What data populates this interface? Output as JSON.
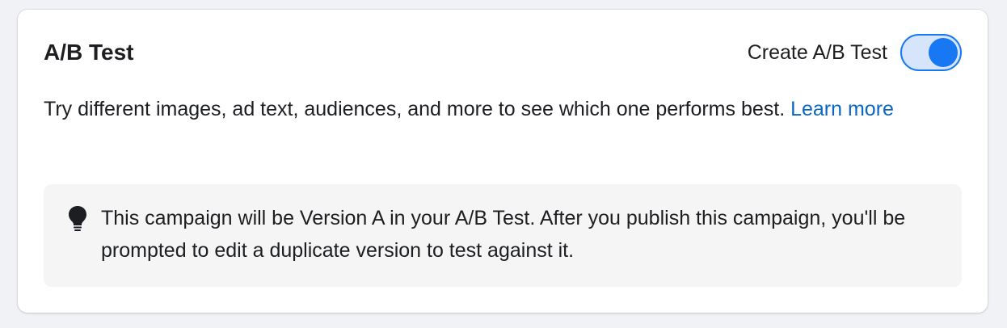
{
  "section": {
    "title": "A/B Test",
    "toggle_label": "Create A/B Test",
    "toggle_on": true
  },
  "description": {
    "text": "Try different images, ad text, audiences, and more to see which one performs best.",
    "link_text": "Learn more"
  },
  "notice": {
    "icon": "lightbulb-icon",
    "text": "This campaign will be Version A in your A/B Test. After you publish this campaign, you'll be prompted to edit a duplicate version to test against it."
  },
  "colors": {
    "accent": "#1877f2",
    "toggle_track": "#d7e5fc",
    "link": "#0a66c2",
    "notice_bg": "#f5f5f5"
  }
}
